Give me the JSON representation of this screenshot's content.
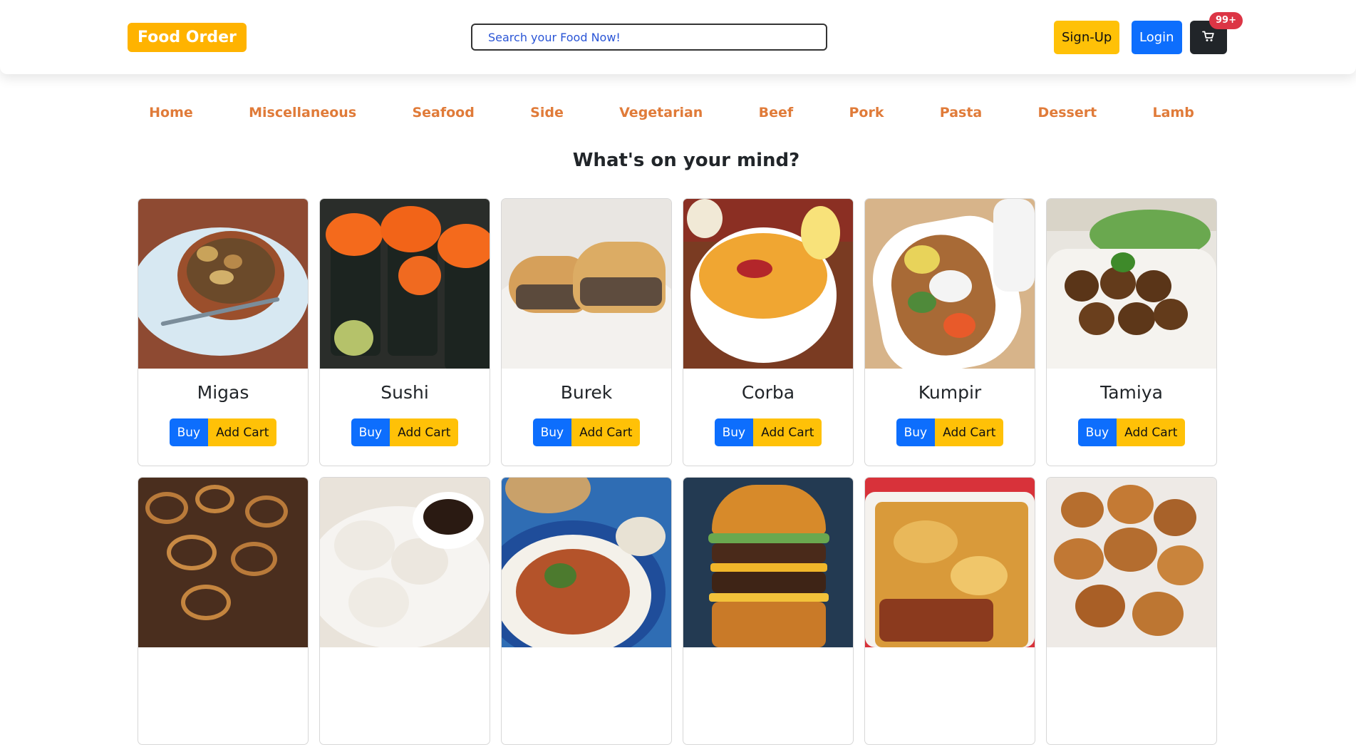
{
  "header": {
    "brand": "Food Order",
    "search_placeholder": "Search your Food Now!",
    "signup_label": "Sign-Up",
    "login_label": "Login",
    "cart_badge": "99+",
    "cart_icon": "cart-icon"
  },
  "categories": [
    "Home",
    "Miscellaneous",
    "Seafood",
    "Side",
    "Vegetarian",
    "Beef",
    "Pork",
    "Pasta",
    "Dessert",
    "Lamb"
  ],
  "section_title": "What's on your mind?",
  "buy_label": "Buy",
  "add_cart_label": "Add Cart",
  "items": [
    {
      "name": "Migas"
    },
    {
      "name": "Sushi"
    },
    {
      "name": "Burek"
    },
    {
      "name": "Corba"
    },
    {
      "name": "Kumpir"
    },
    {
      "name": "Tamiya"
    },
    {
      "name": ""
    },
    {
      "name": ""
    },
    {
      "name": ""
    },
    {
      "name": ""
    },
    {
      "name": ""
    },
    {
      "name": ""
    }
  ],
  "colors": {
    "brand": "#ffb300",
    "primary": "#0d6efd",
    "warning": "#ffc107",
    "category": "#e07b39",
    "badge": "#dc3545",
    "dark": "#212529"
  }
}
